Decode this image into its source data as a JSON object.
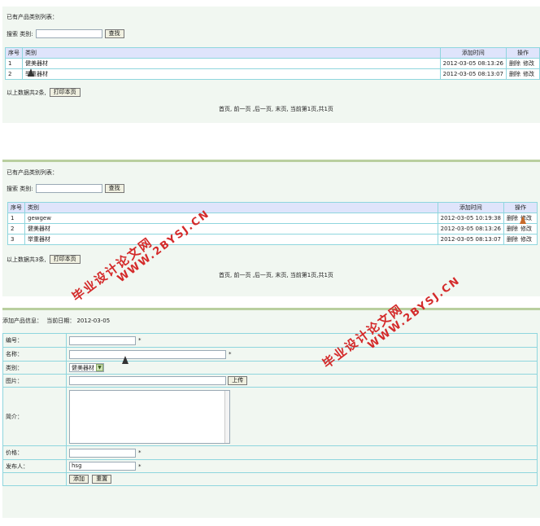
{
  "panel1": {
    "heading": "已有产品类别列表：",
    "search_label": "搜索 类别:",
    "search_value": "",
    "search_button": "查找",
    "headers": [
      "序号",
      "类别",
      "添加时间",
      "操作"
    ],
    "rows": [
      {
        "no": "1",
        "name": "健美器材",
        "time": "2012-03-05 08:13:26",
        "del": "删除",
        "edit": "修改"
      },
      {
        "no": "2",
        "name": "举重器材",
        "time": "2012-03-05 08:13:07",
        "del": "删除",
        "edit": "修改"
      }
    ],
    "total_text": "以上数据共2条,",
    "print_button": "打印本页",
    "pager": "首页, 前一页 ,后一页, 末页, 当前第1页,共1页"
  },
  "panel2": {
    "heading": "已有产品类别列表：",
    "search_label": "搜索 类别:",
    "search_value": "",
    "search_button": "查找",
    "headers": [
      "序号",
      "类别",
      "添加时间",
      "操作"
    ],
    "rows": [
      {
        "no": "1",
        "name": "gewgew",
        "time": "2012-03-05 10:19:38",
        "del": "删除",
        "edit": "修改"
      },
      {
        "no": "2",
        "name": "健美器材",
        "time": "2012-03-05 08:13:26",
        "del": "删除",
        "edit": "修改"
      },
      {
        "no": "3",
        "name": "举重器材",
        "time": "2012-03-05 08:13:07",
        "del": "删除",
        "edit": "修改"
      }
    ],
    "total_text": "以上数据共3条,",
    "print_button": "打印本页",
    "pager": "首页, 前一页 ,后一页, 末页, 当前第1页,共1页"
  },
  "panel3": {
    "heading": "添加产品信息：",
    "date_label": "当前日期：",
    "date_value": "2012-03-05",
    "fields": {
      "code_label": "编号：",
      "code_value": "",
      "name_label": "名称：",
      "name_value": "",
      "category_label": "类别：",
      "category_value": "健美器材",
      "image_label": "图片：",
      "image_value": "",
      "upload_button": "上传",
      "intro_label": "简介：",
      "price_label": "价格：",
      "price_value": "",
      "publisher_label": "发布人：",
      "publisher_value": "hsg",
      "required_mark": "*"
    },
    "add_button": "添加",
    "reset_button": "重置"
  },
  "watermarks": [
    {
      "line1": "毕业设计论文网",
      "line2": "WWW.2BYSJ.CN"
    },
    {
      "line1": "毕业设计论文网",
      "line2": "WWW.2BYSJ.CN"
    }
  ],
  "colors": {
    "panel_bg": "#f1f7f1",
    "table_border": "#8fd6de",
    "header_bg": "#dfe4fb",
    "separator": "#b9cf9f",
    "watermark": "#d42a2a"
  }
}
